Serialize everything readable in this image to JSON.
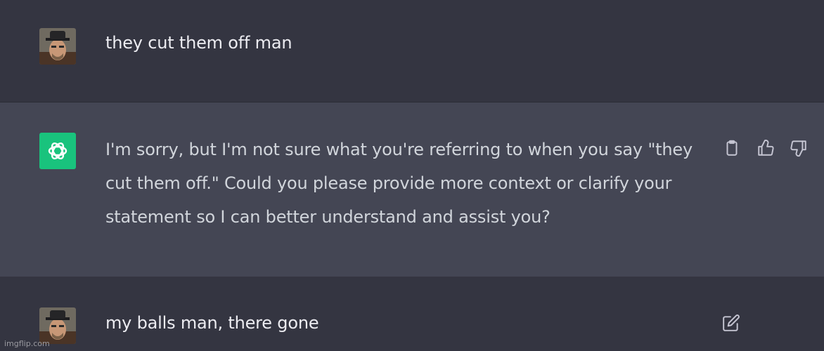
{
  "conversation": {
    "messages": [
      {
        "role": "user",
        "text": "they cut them off man"
      },
      {
        "role": "assistant",
        "text": "I'm sorry, but I'm not sure what you're referring to when you say \"they cut them off.\" Could you please provide more context or clarify your statement so I can better understand and assist you?"
      },
      {
        "role": "user",
        "text": "my balls man, there gone"
      }
    ]
  },
  "icons": {
    "copy": "clipboard-icon",
    "like": "thumbs-up-icon",
    "dislike": "thumbs-down-icon",
    "edit": "edit-icon",
    "assistant_avatar": "openai-logo-icon"
  },
  "colors": {
    "background": "#343541",
    "assistant_row": "#444654",
    "assistant_avatar": "#19c37d",
    "text": "#ececf1",
    "icon": "#c5c5d2"
  },
  "watermark": "imgflip.com"
}
